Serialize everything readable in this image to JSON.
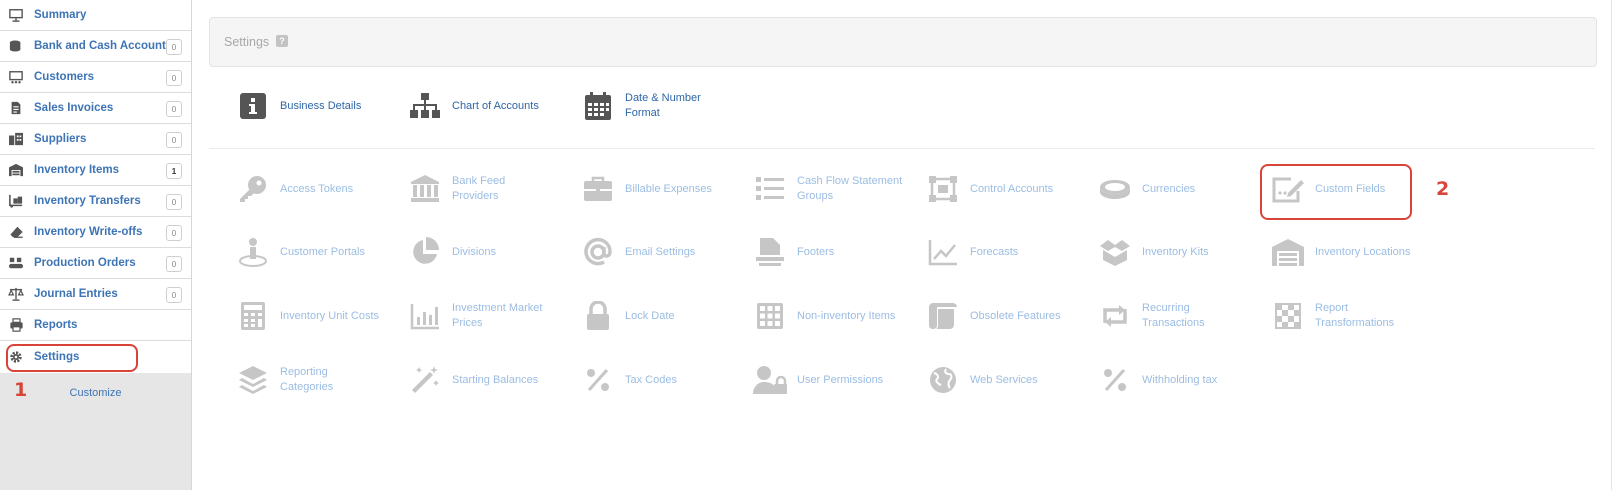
{
  "sidebar": {
    "items": [
      {
        "label": "Summary",
        "icon": "presentation-icon",
        "count": ""
      },
      {
        "label": "Bank and Cash Accounts",
        "icon": "coins-icon",
        "count": "0"
      },
      {
        "label": "Customers",
        "icon": "customers-icon",
        "count": "0"
      },
      {
        "label": "Sales Invoices",
        "icon": "invoice-icon",
        "count": "0"
      },
      {
        "label": "Suppliers",
        "icon": "building-icon",
        "count": "0"
      },
      {
        "label": "Inventory Items",
        "icon": "warehouse-icon",
        "count": "1"
      },
      {
        "label": "Inventory Transfers",
        "icon": "dolly-icon",
        "count": "0"
      },
      {
        "label": "Inventory Write-offs",
        "icon": "eraser-icon",
        "count": "0"
      },
      {
        "label": "Production Orders",
        "icon": "conveyor-icon",
        "count": "0"
      },
      {
        "label": "Journal Entries",
        "icon": "balance-scale-icon",
        "count": "0"
      },
      {
        "label": "Reports",
        "icon": "printer-icon",
        "count": ""
      },
      {
        "label": "Settings",
        "icon": "gear-icon",
        "count": ""
      }
    ],
    "customize": "Customize"
  },
  "settings_panel": {
    "title": "Settings",
    "help": "?"
  },
  "top_items": [
    {
      "label": "Business Details",
      "icon": "info-icon"
    },
    {
      "label": "Chart of Accounts",
      "icon": "sitemap-icon"
    },
    {
      "label": "Date & Number\nFormat",
      "icon": "calendar-icon"
    }
  ],
  "grid_items": [
    {
      "label": "Access Tokens",
      "icon": "key-icon"
    },
    {
      "label": "Bank Feed\nProviders",
      "icon": "bank-icon"
    },
    {
      "label": "Billable Expenses",
      "icon": "briefcase-icon"
    },
    {
      "label": "Cash Flow Statement\nGroups",
      "icon": "list-icon"
    },
    {
      "label": "Control Accounts",
      "icon": "vector-square-icon"
    },
    {
      "label": "Currencies",
      "icon": "coin-icon"
    },
    {
      "label": "Custom Fields",
      "icon": "edit-icon"
    },
    {
      "label": "Customer Portals",
      "icon": "portal-icon"
    },
    {
      "label": "Divisions",
      "icon": "pie-chart-icon"
    },
    {
      "label": "Email Settings",
      "icon": "at-icon"
    },
    {
      "label": "Footers",
      "icon": "footer-icon"
    },
    {
      "label": "Forecasts",
      "icon": "line-chart-icon"
    },
    {
      "label": "Inventory Kits",
      "icon": "boxes-icon"
    },
    {
      "label": "Inventory Locations",
      "icon": "warehouse-icon"
    },
    {
      "label": "Inventory Unit Costs",
      "icon": "calculator-icon"
    },
    {
      "label": "Investment Market\nPrices",
      "icon": "bar-chart-icon"
    },
    {
      "label": "Lock Date",
      "icon": "lock-icon"
    },
    {
      "label": "Non-inventory Items",
      "icon": "grid-icon"
    },
    {
      "label": "Obsolete Features",
      "icon": "scroll-icon"
    },
    {
      "label": "Recurring\nTransactions",
      "icon": "retweet-icon"
    },
    {
      "label": "Report\nTransformations",
      "icon": "chess-board-icon"
    },
    {
      "label": "Reporting\nCategories",
      "icon": "layers-icon"
    },
    {
      "label": "Starting Balances",
      "icon": "magic-icon"
    },
    {
      "label": "Tax Codes",
      "icon": "percent-icon"
    },
    {
      "label": "User Permissions",
      "icon": "user-lock-icon"
    },
    {
      "label": "Web Services",
      "icon": "globe-icon"
    },
    {
      "label": "Withholding tax",
      "icon": "percent-icon"
    }
  ],
  "annotations": {
    "one": "1",
    "two": "2"
  }
}
